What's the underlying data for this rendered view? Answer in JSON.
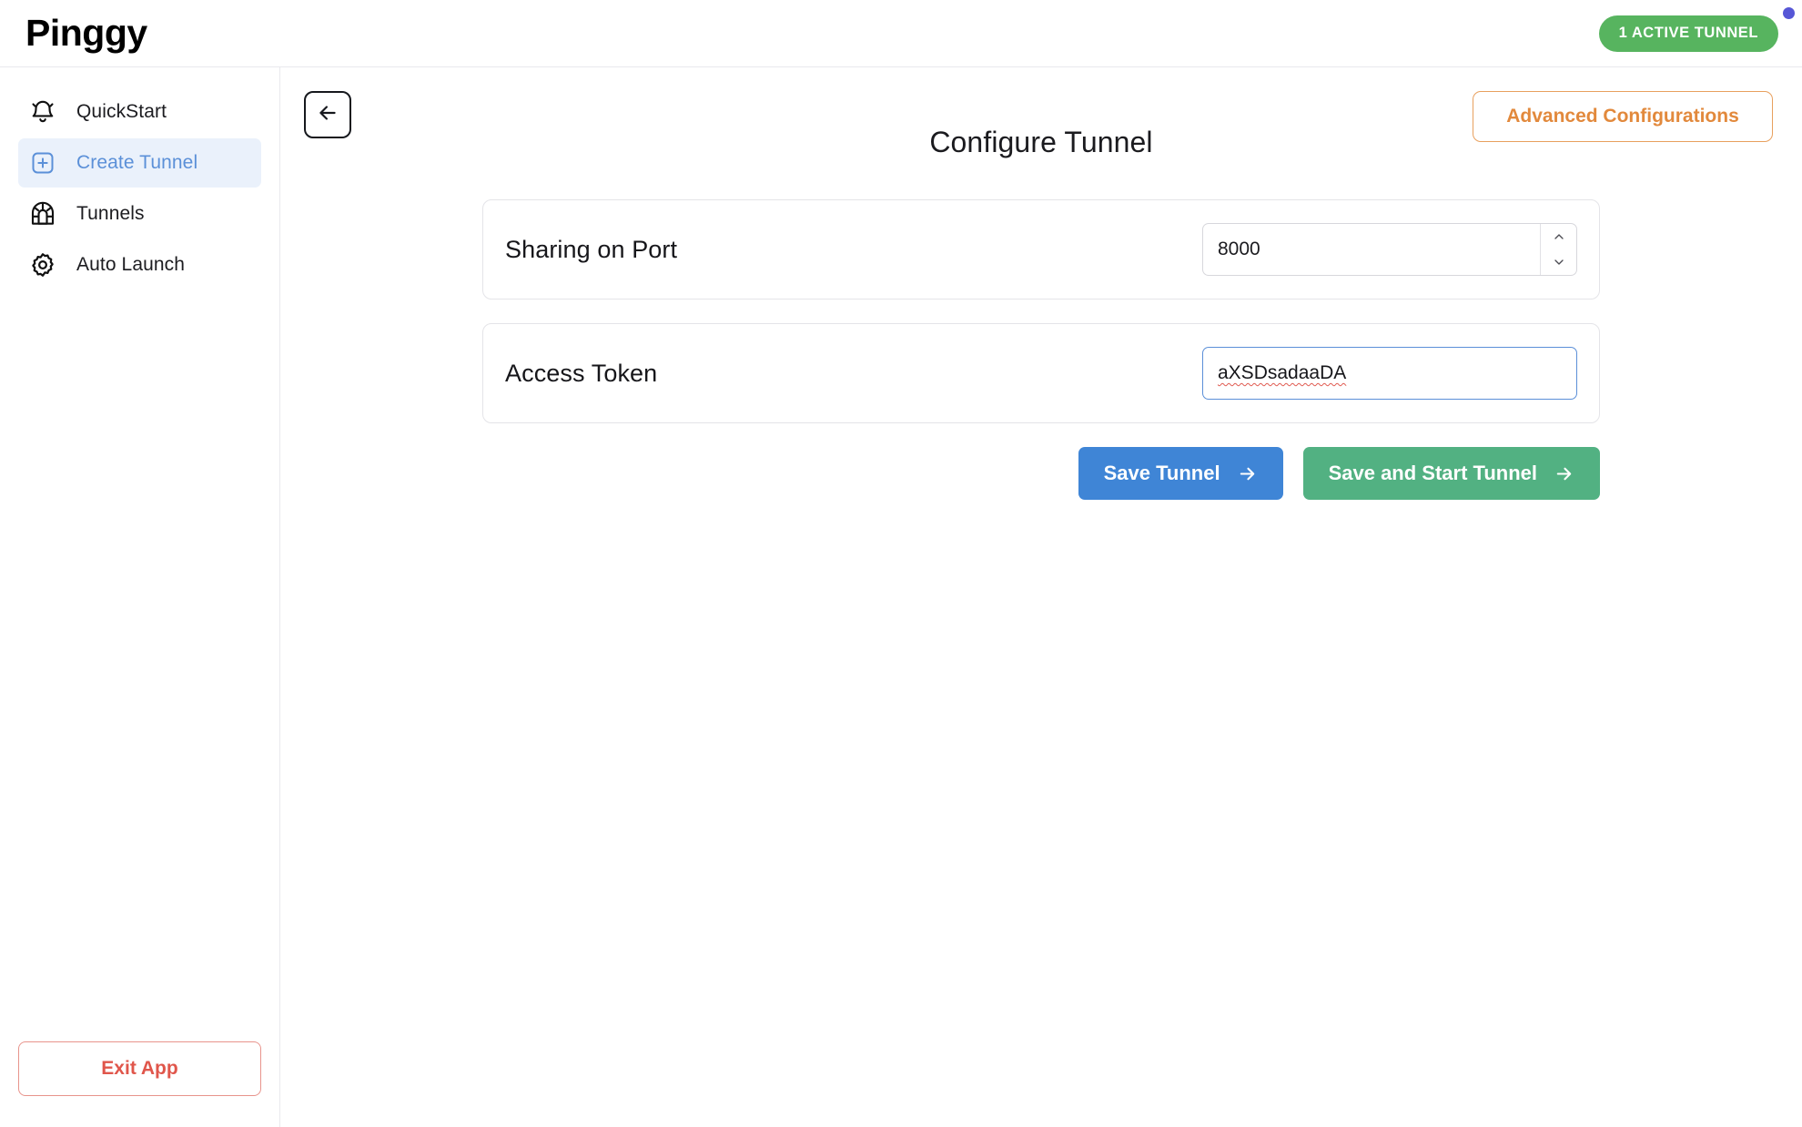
{
  "header": {
    "logo": "Pinggy",
    "badge": "1 ACTIVE TUNNEL",
    "badge_color": "#57b45f",
    "corner_dot_color": "#5656d6"
  },
  "sidebar": {
    "items": [
      {
        "label": "QuickStart",
        "icon": "bell-icon",
        "active": false
      },
      {
        "label": "Create Tunnel",
        "icon": "plus-square-icon",
        "active": true
      },
      {
        "label": "Tunnels",
        "icon": "tunnel-arch-icon",
        "active": false
      },
      {
        "label": "Auto Launch",
        "icon": "gear-icon",
        "active": false
      }
    ],
    "exit_label": "Exit App",
    "exit_color": "#e0564b"
  },
  "main": {
    "back_icon": "arrow-left-icon",
    "advanced_label": "Advanced Configurations",
    "advanced_color": "#e2893c",
    "title": "Configure Tunnel",
    "fields": [
      {
        "label": "Sharing on Port",
        "type": "number",
        "value": "8000",
        "placeholder": "8000"
      },
      {
        "label": "Access Token",
        "type": "text",
        "value": "aXSDsadaaDA",
        "placeholder": "Access Token",
        "focused": true,
        "spellcheck_error": true
      }
    ],
    "buttons": {
      "save": {
        "label": "Save Tunnel",
        "color": "#3f85d6"
      },
      "save_start": {
        "label": "Save and Start Tunnel",
        "color": "#52b182"
      }
    }
  }
}
